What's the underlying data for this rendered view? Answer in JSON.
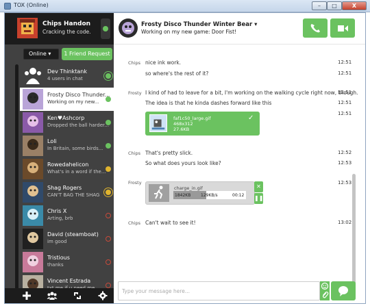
{
  "window": {
    "title": "TOX (Online)",
    "min_label": "–",
    "max_label": "□",
    "close_label": "X"
  },
  "self": {
    "name": "Chips Handon",
    "status": "Cracking the code."
  },
  "controls": {
    "status_select": "Online ▾",
    "friend_request": "1 Friend Request"
  },
  "contacts": [
    {
      "name": "Dev Thinktank",
      "status": "4 users in chat",
      "state": "online-ring"
    },
    {
      "name": "Frosty Disco Thunder...",
      "status": "Working on my new...",
      "state": "online"
    },
    {
      "name": "Ken♥Ashcorp",
      "status": "Dropped the ball harder...",
      "state": "online"
    },
    {
      "name": "Loli",
      "status": "In Britain, some birds...",
      "state": "online"
    },
    {
      "name": "Rowedahelicon",
      "status": "What's in a word if the...",
      "state": "away"
    },
    {
      "name": "Shag Rogers",
      "status": "CAN'T BAG THE SHAG",
      "state": "away-ring"
    },
    {
      "name": "Chris X",
      "status": "Arting, brb",
      "state": "offline"
    },
    {
      "name": "David (steamboat)",
      "status": "im good",
      "state": "offline"
    },
    {
      "name": "Tristious",
      "status": "thanks",
      "state": "offline"
    },
    {
      "name": "Vincent Estrada",
      "status": "txt me if u need me",
      "state": "offline"
    }
  ],
  "chat": {
    "name": "Frosty Disco Thunder Winter Bear ▾",
    "status": "Working on my new game: Door Fist!"
  },
  "messages": [
    {
      "author": "Chips",
      "text": "nice ink work.",
      "time": "12:51"
    },
    {
      "author": "",
      "text": "so where's the rest of it?",
      "time": "12:51"
    },
    {
      "author": "Frosty",
      "text": "I kind of had to leave for a bit, I'm working on the walking cycle right now, though.",
      "time": "12:51"
    },
    {
      "author": "",
      "text": "The idea is that he kinda dashes forward like this",
      "time": "12:51"
    },
    {
      "author": "",
      "text": "",
      "time": "12:51"
    },
    {
      "author": "Chips",
      "text": "That's pretty slick.",
      "time": "12:52"
    },
    {
      "author": "",
      "text": "So what does yours look like?",
      "time": "12:53"
    },
    {
      "author": "Frosty",
      "text": "",
      "time": "12:53"
    },
    {
      "author": "Chips",
      "text": "Can't wait to see it!",
      "time": "13:02"
    }
  ],
  "file_done": {
    "name": "faf1c50_large.gif",
    "dims": "468x312",
    "size": "27.6KB"
  },
  "file_transfer": {
    "name": "charge_in.gif",
    "size": "1842KB",
    "speed": "129KB/s",
    "eta": "00:12",
    "progress": 0.45
  },
  "composer": {
    "placeholder": "Type your message here..."
  },
  "colors": {
    "accent": "#6bc260",
    "sidebar": "#414141",
    "sidebar_dark": "#1c1c1c",
    "offline": "#c84a3a",
    "away": "#e0b42e"
  }
}
